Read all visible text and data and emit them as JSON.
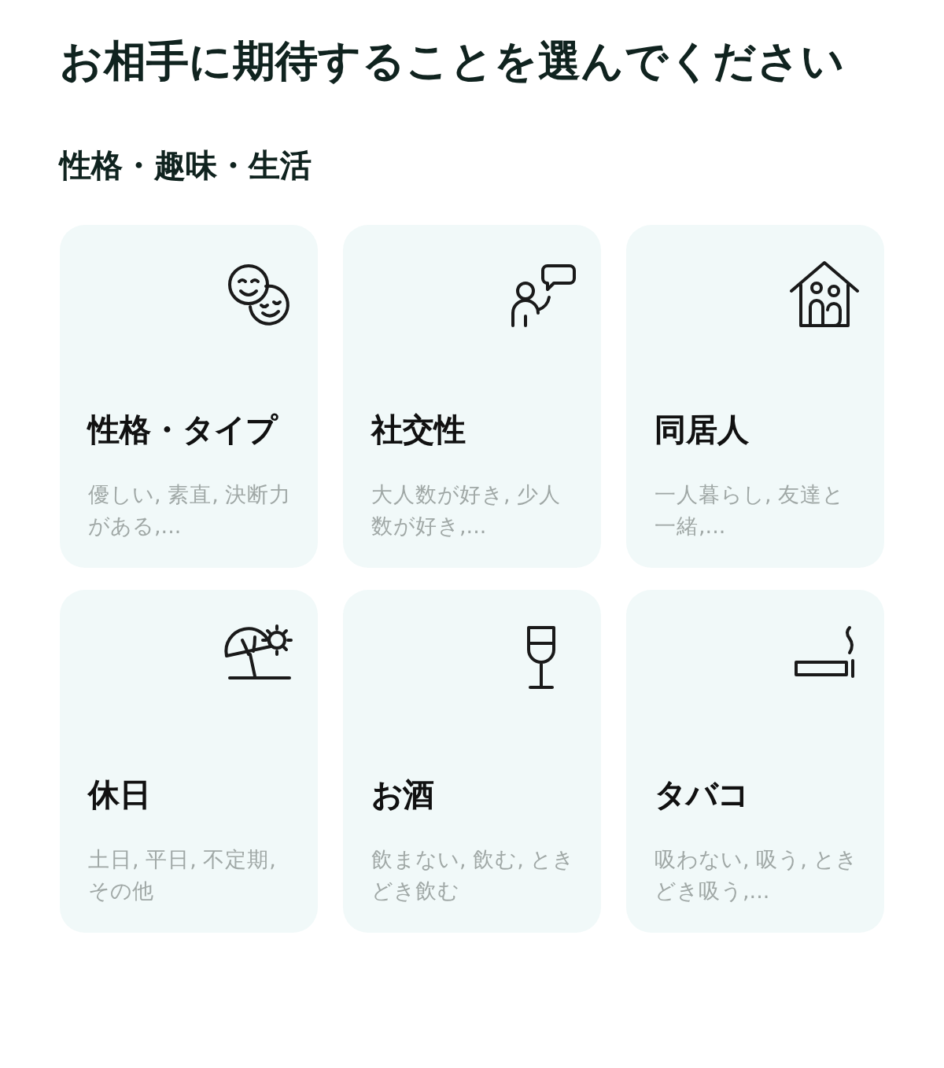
{
  "title": "お相手に期待することを選んでください",
  "section": {
    "heading": "性格・趣味・生活",
    "cards": [
      {
        "title": "性格・タイプ",
        "description": "優しい, 素直, 決断力がある,..."
      },
      {
        "title": "社交性",
        "description": "大人数が好き, 少人数が好き,..."
      },
      {
        "title": "同居人",
        "description": "一人暮らし, 友達と一緒,..."
      },
      {
        "title": "休日",
        "description": "土日, 平日, 不定期, その他"
      },
      {
        "title": "お酒",
        "description": "飲まない, 飲む, ときどき飲む"
      },
      {
        "title": "タバコ",
        "description": "吸わない, 吸う, ときどき吸う,..."
      }
    ]
  }
}
